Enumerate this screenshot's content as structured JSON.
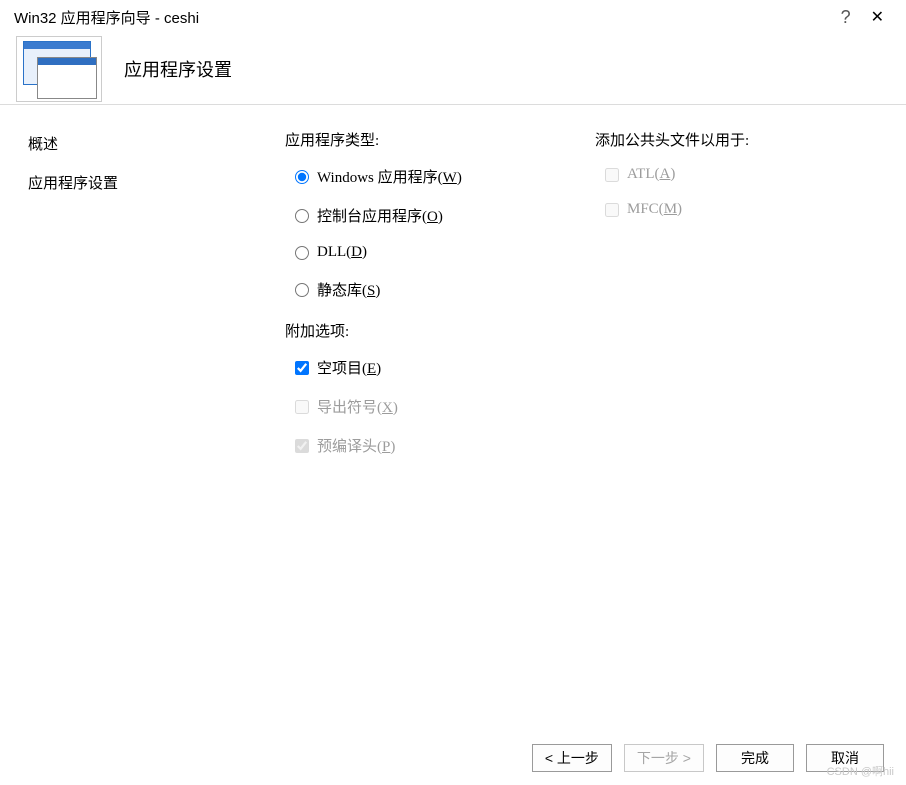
{
  "titlebar": {
    "title": "Win32 应用程序向导 - ceshi",
    "help": "?",
    "close": "✕"
  },
  "banner": {
    "heading": "应用程序设置"
  },
  "sidebar": {
    "items": [
      {
        "label": "概述"
      },
      {
        "label": "应用程序设置"
      }
    ]
  },
  "apptype": {
    "title": "应用程序类型:",
    "options": [
      {
        "label": "Windows 应用程序(",
        "mn": "W",
        "tail": ")",
        "checked": true
      },
      {
        "label": "控制台应用程序(",
        "mn": "O",
        "tail": ")",
        "checked": false
      },
      {
        "label": "DLL(",
        "mn": "D",
        "tail": ")",
        "checked": false
      },
      {
        "label": "静态库(",
        "mn": "S",
        "tail": ")",
        "checked": false
      }
    ]
  },
  "extra": {
    "title": "附加选项:",
    "options": [
      {
        "label": "空项目(",
        "mn": "E",
        "tail": ")",
        "checked": true,
        "disabled": false
      },
      {
        "label": "导出符号(",
        "mn": "X",
        "tail": ")",
        "checked": false,
        "disabled": true
      },
      {
        "label": "预编译头(",
        "mn": "P",
        "tail": ")",
        "checked": true,
        "disabled": true
      }
    ]
  },
  "headers": {
    "title": "添加公共头文件以用于:",
    "options": [
      {
        "label": "ATL(",
        "mn": "A",
        "tail": ")",
        "checked": false,
        "disabled": true
      },
      {
        "label": "MFC(",
        "mn": "M",
        "tail": ")",
        "checked": false,
        "disabled": true
      }
    ]
  },
  "footer": {
    "prev": "< 上一步",
    "next": "下一步 >",
    "finish": "完成",
    "cancel": "取消"
  },
  "watermark": "CSDN @啊hii"
}
